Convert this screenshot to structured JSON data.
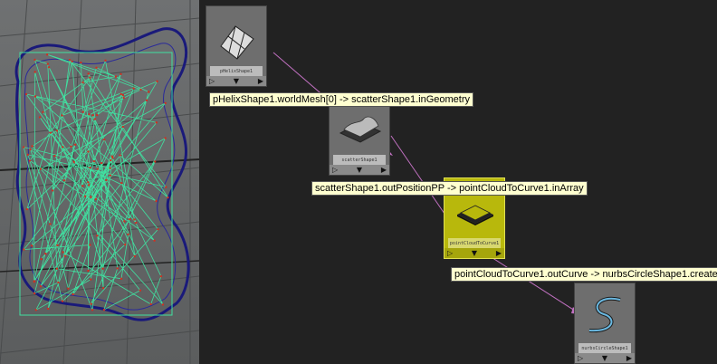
{
  "nodes": [
    {
      "id": "helix",
      "name": "pHelixShape1"
    },
    {
      "id": "scatter",
      "name": "scatterShape1"
    },
    {
      "id": "pointcloud",
      "name": "pointCloudToCurve1"
    },
    {
      "id": "nurbs",
      "name": "nurbsCircleShape1"
    }
  ],
  "connections": [
    {
      "label": "pHelixShape1.worldMesh[0] -> scatterShape1.inGeometry"
    },
    {
      "label": "scatterShape1.outPositionPP -> pointCloudToCurve1.inArray"
    },
    {
      "label": "pointCloudToCurve1.outCurve -> nurbsCircleShape1.create"
    }
  ],
  "port_glyphs": {
    "left": "▷",
    "mid": "▼",
    "right": "▶"
  },
  "colors": {
    "graph_bg": "#222222",
    "node": "#6e6e6e",
    "node_selected": "#b8b80c",
    "wire": "#c070c0",
    "tooltip_bg": "#ffffd0",
    "mesh_wire": "#1a1a7a",
    "curve": "#40e0a0"
  }
}
